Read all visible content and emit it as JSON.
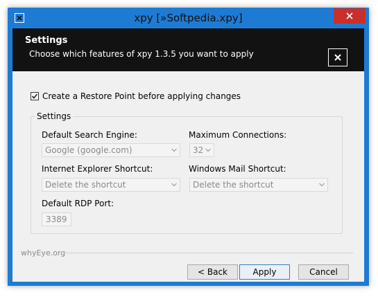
{
  "window": {
    "title": "xpy [»Softpedia.xpy]"
  },
  "header": {
    "title": "Settings",
    "subtitle": "Choose which features of xpy 1.3.5 you want to apply"
  },
  "restore_point": {
    "label": "Create a Restore Point before applying changes",
    "checked": true
  },
  "settings_group": {
    "label": "Settings",
    "search_engine": {
      "label": "Default Search Engine:",
      "value": "Google (google.com)"
    },
    "max_connections": {
      "label": "Maximum Connections:",
      "value": "32"
    },
    "ie_shortcut": {
      "label": "Internet Explorer Shortcut:",
      "value": "Delete the shortcut"
    },
    "mail_shortcut": {
      "label": "Windows Mail Shortcut:",
      "value": "Delete the shortcut"
    },
    "rdp_port": {
      "label": "Default RDP Port:",
      "value": "3389"
    }
  },
  "footer": {
    "brand": "whyEye.org",
    "back_label": "< Back",
    "apply_label": "Apply",
    "cancel_label": "Cancel"
  },
  "colors": {
    "frame": "#1e7bd4",
    "close": "#c9302c",
    "header_bg": "#121212"
  }
}
